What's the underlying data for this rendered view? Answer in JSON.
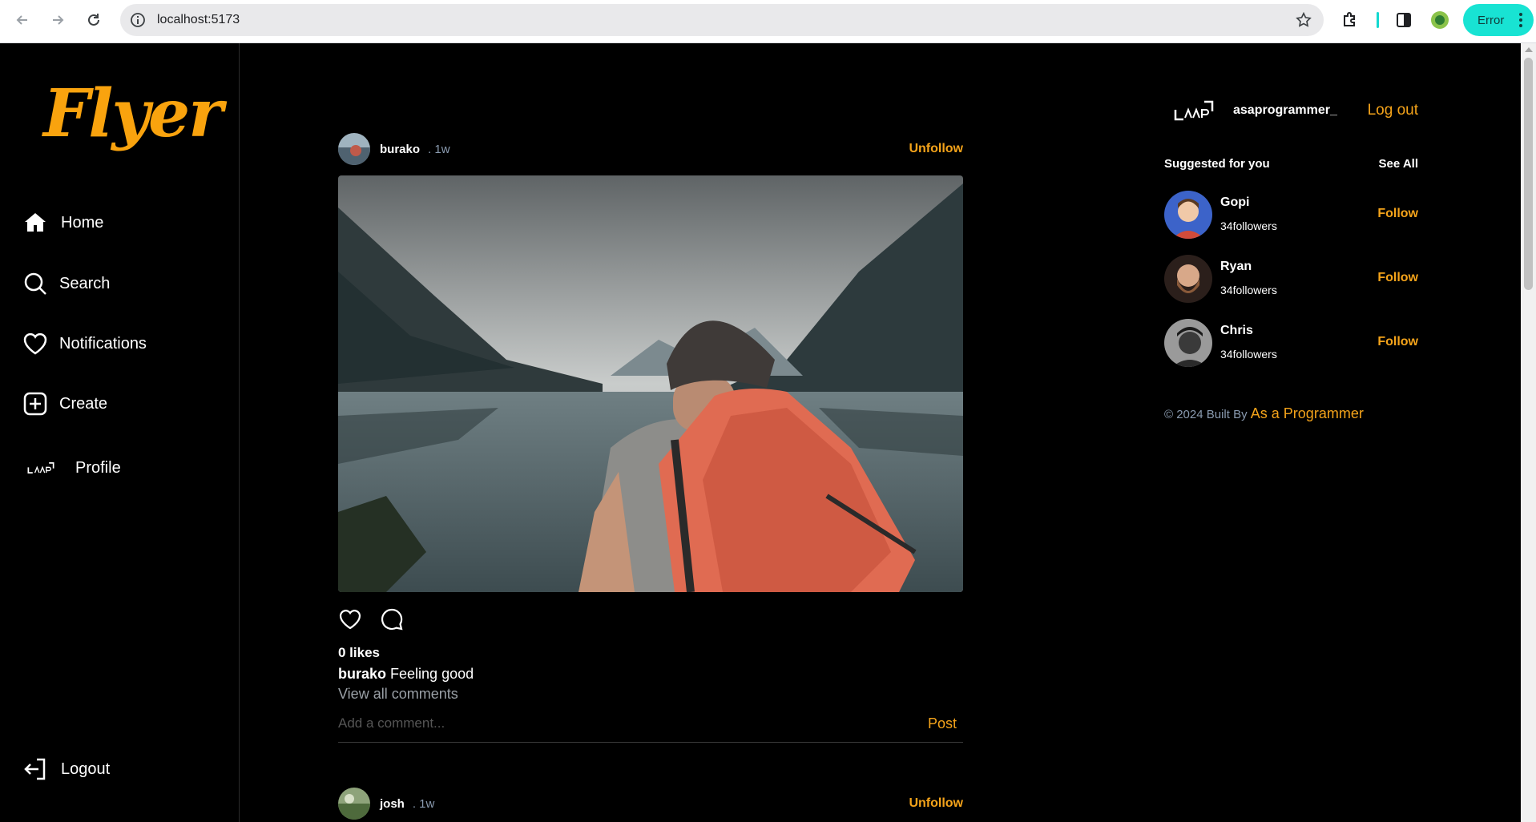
{
  "browser": {
    "url": "localhost:5173",
    "error_label": "Error"
  },
  "sidebar": {
    "logo": "Flyer",
    "items": [
      {
        "label": "Home",
        "icon": "home-icon"
      },
      {
        "label": "Search",
        "icon": "search-icon"
      },
      {
        "label": "Notifications",
        "icon": "heart-icon"
      },
      {
        "label": "Create",
        "icon": "plus-square-icon"
      },
      {
        "label": "Profile",
        "icon": "profile-avatar-icon"
      }
    ],
    "logout_label": "Logout"
  },
  "feed": {
    "posts": [
      {
        "username": "burako",
        "time": ". 1w",
        "follow_label": "Unfollow",
        "likes": "0 likes",
        "caption_user": "burako",
        "caption_text": "Feeling good",
        "view_comments": "View all comments",
        "comment_placeholder": "Add a comment...",
        "post_label": "Post"
      },
      {
        "username": "josh",
        "time": ". 1w",
        "follow_label": "Unfollow"
      }
    ]
  },
  "right": {
    "current_user": "asaprogrammer_",
    "logout_label": "Log out",
    "suggested_title": "Suggested for you",
    "see_all": "See All",
    "suggestions": [
      {
        "name": "Gopi",
        "followers": "34followers",
        "action": "Follow"
      },
      {
        "name": "Ryan",
        "followers": "34followers",
        "action": "Follow"
      },
      {
        "name": "Chris",
        "followers": "34followers",
        "action": "Follow"
      }
    ],
    "footer_prefix": "© 2024 Built By",
    "footer_link": "As a Programmer"
  },
  "colors": {
    "accent": "#f4a31a",
    "logo": "#f9a30e",
    "background": "#000000"
  }
}
